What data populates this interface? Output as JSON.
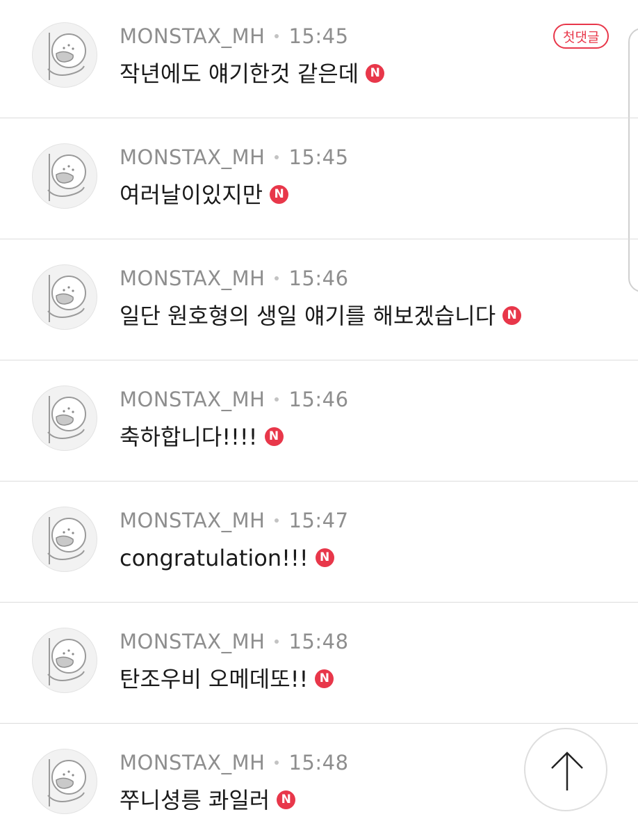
{
  "comments": [
    {
      "author": "MONSTAX_MH",
      "time": "15:45",
      "text": "작년에도 얘기한것 같은데",
      "badge": "N",
      "tag": "첫댓글"
    },
    {
      "author": "MONSTAX_MH",
      "time": "15:45",
      "text": "여러날이있지만",
      "badge": "N"
    },
    {
      "author": "MONSTAX_MH",
      "time": "15:46",
      "text": "일단 원호형의 생일 얘기를 해보겠습니다",
      "badge": "N"
    },
    {
      "author": "MONSTAX_MH",
      "time": "15:46",
      "text": "축하합니다!!!!",
      "badge": "N"
    },
    {
      "author": "MONSTAX_MH",
      "time": "15:47",
      "text": "congratulation!!!",
      "badge": "N"
    },
    {
      "author": "MONSTAX_MH",
      "time": "15:48",
      "text": "탄조우비 오메데또!!",
      "badge": "N"
    },
    {
      "author": "MONSTAX_MH",
      "time": "15:48",
      "text": "쭈니셩릉 콰일러",
      "badge": "N"
    }
  ],
  "icons": {
    "avatar": "default-profile-avatar-icon",
    "scroll_top": "arrow-up-icon"
  },
  "colors": {
    "accent": "#e8374a",
    "meta_text": "#8e8e8e",
    "body_text": "#1a1a1a",
    "divider": "#dcdcdc"
  }
}
